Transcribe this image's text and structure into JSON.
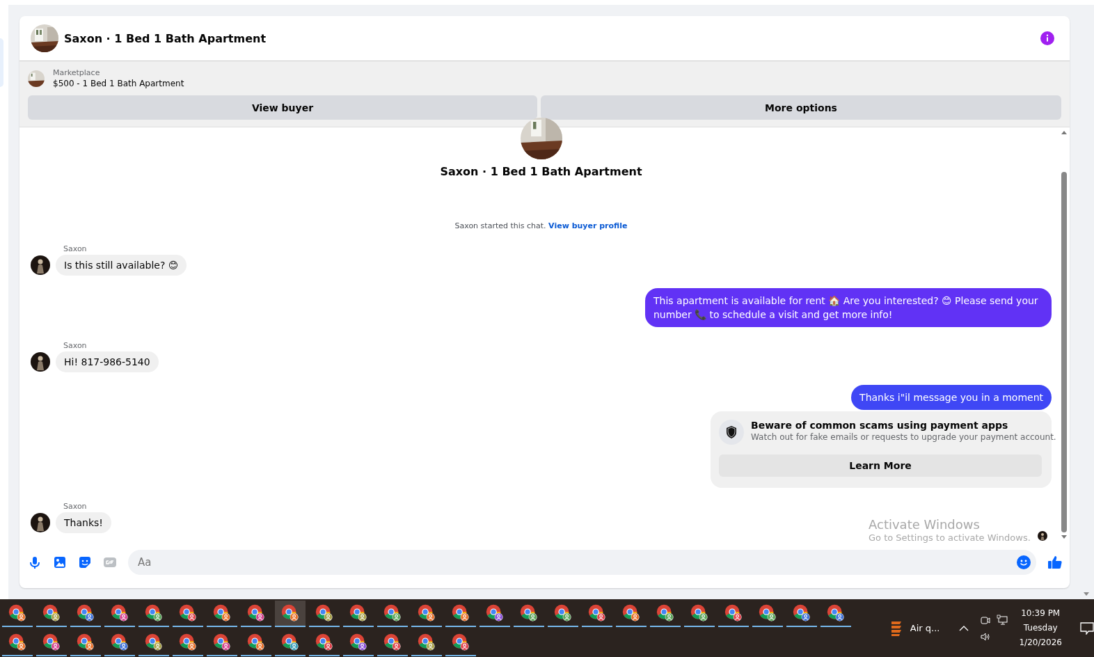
{
  "header": {
    "title": "Saxon · 1 Bed 1 Bath Apartment"
  },
  "listing": {
    "source": "Marketplace",
    "title": "$500 - 1 Bed 1 Bath Apartment",
    "buttons": [
      "View buyer",
      "More options"
    ]
  },
  "chat_intro": {
    "title": "Saxon · 1 Bed 1 Bath Apartment",
    "notice": "Saxon started this chat.",
    "link": "View buyer profile"
  },
  "messages": [
    {
      "kind": "incoming",
      "sender": "Saxon",
      "text": "Is this still available? 😊"
    },
    {
      "kind": "outgoing",
      "text": "This apartment is available for rent 🏠 Are you interested? 😊 Please send your number 📞 to schedule a visit and get more info!",
      "color": "#6132f5"
    },
    {
      "kind": "incoming",
      "sender": "Saxon",
      "text": "Hi! 817-986-5140"
    },
    {
      "kind": "outgoing",
      "text": "Thanks i\"il message you in a moment",
      "color": "#3f47f5"
    },
    {
      "kind": "safety",
      "title": "Beware of common scams using payment apps",
      "text": "Watch out for fake emails or requests to upgrade your payment account.",
      "button": "Learn More"
    },
    {
      "kind": "incoming",
      "sender": "Saxon",
      "text": "Thanks!"
    }
  ],
  "composer": {
    "placeholder": "Aa"
  },
  "activation": {
    "title": "Activate Windows",
    "text": "Go to Settings to activate Windows."
  },
  "taskbar": {
    "apps": [
      {
        "color": "#e8702a",
        "selected": false
      },
      {
        "color": "#a7a04a",
        "selected": false
      },
      {
        "color": "#3b6fd8",
        "selected": false
      },
      {
        "color": "#d6418f",
        "selected": false
      },
      {
        "color": "#5aa55a",
        "selected": false
      },
      {
        "color": "#e0404a",
        "selected": false
      },
      {
        "color": "#e8702a",
        "selected": false
      },
      {
        "color": "#d6418f",
        "selected": false
      },
      {
        "color": "#e8702a",
        "selected": true
      },
      {
        "color": "#a7a04a",
        "selected": false
      },
      {
        "color": "#a7a04a",
        "selected": false
      },
      {
        "color": "#5aa55a",
        "selected": false
      },
      {
        "color": "#e8702a",
        "selected": false
      },
      {
        "color": "#e8702a",
        "selected": false
      },
      {
        "color": "#8a4fd8",
        "selected": false
      },
      {
        "color": "#5aa55a",
        "selected": false
      },
      {
        "color": "#5aa55a",
        "selected": false
      },
      {
        "color": "#e0404a",
        "selected": false
      },
      {
        "color": "#e8702a",
        "selected": false
      },
      {
        "color": "#5aa55a",
        "selected": false
      },
      {
        "color": "#5aa55a",
        "selected": false
      },
      {
        "color": "#e0404a",
        "selected": false
      },
      {
        "color": "#5aa55a",
        "selected": false
      },
      {
        "color": "#3b6fd8",
        "selected": false
      },
      {
        "color": "#3b6fd8",
        "selected": false
      },
      {
        "color": "#e8702a",
        "selected": false
      },
      {
        "color": "#d6418f",
        "selected": false
      },
      {
        "color": "#e8702a",
        "selected": false
      },
      {
        "color": "#3b6fd8",
        "selected": false
      },
      {
        "color": "#a7a04a",
        "selected": false
      },
      {
        "color": "#e8702a",
        "selected": false
      },
      {
        "color": "#d6418f",
        "selected": false
      },
      {
        "color": "#e8702a",
        "selected": false
      },
      {
        "color": "#3aa0b8",
        "selected": false
      },
      {
        "color": "#e0404a",
        "selected": false
      },
      {
        "color": "#8a4fd8",
        "selected": false
      },
      {
        "color": "#e0404a",
        "selected": false
      },
      {
        "color": "#a7a04a",
        "selected": false
      },
      {
        "color": "#e0404a",
        "selected": false
      }
    ],
    "weather": "Air q...",
    "time": "10:39 PM",
    "day": "Tuesday",
    "date": "1/20/2026"
  }
}
